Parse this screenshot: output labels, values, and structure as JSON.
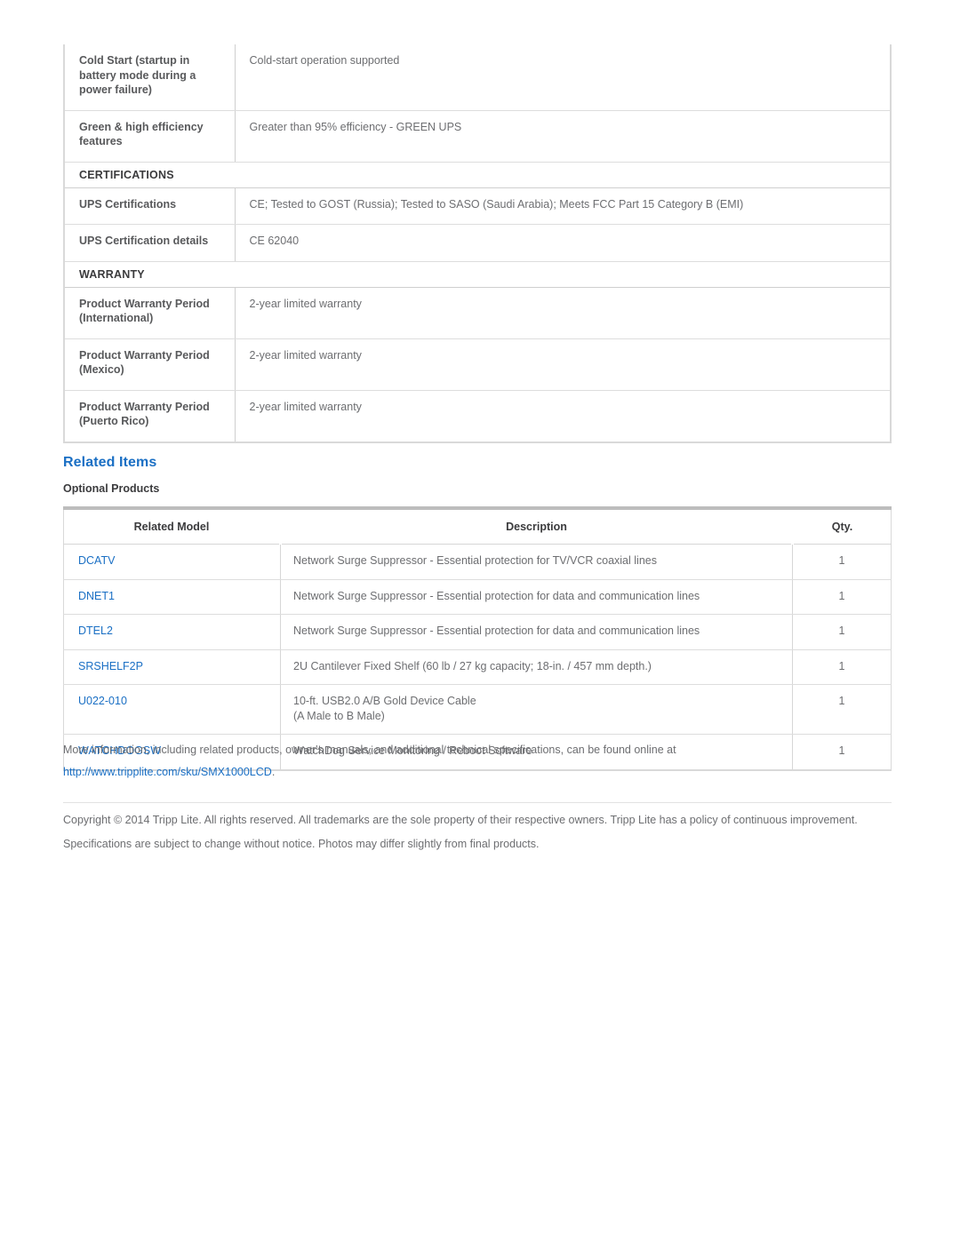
{
  "spec_table": {
    "rows": [
      {
        "kind": "row",
        "label": "Cold Start (startup in battery mode during a power failure)",
        "value": "Cold-start operation supported"
      },
      {
        "kind": "row",
        "label": "Green & high efficiency features",
        "value": "Greater than 95% efficiency - GREEN UPS"
      },
      {
        "kind": "section",
        "label": "CERTIFICATIONS"
      },
      {
        "kind": "row",
        "label": "UPS Certifications",
        "value": "CE; Tested to GOST (Russia); Tested to SASO (Saudi Arabia); Meets FCC Part 15 Category B (EMI)"
      },
      {
        "kind": "row",
        "label": "UPS Certification details",
        "value": "CE 62040"
      },
      {
        "kind": "section",
        "label": "WARRANTY"
      },
      {
        "kind": "row",
        "label": "Product Warranty Period (International)",
        "value": "2-year limited warranty"
      },
      {
        "kind": "row",
        "label": "Product Warranty Period (Mexico)",
        "value": "2-year limited warranty"
      },
      {
        "kind": "row",
        "label": "Product Warranty Period (Puerto Rico)",
        "value": "2-year limited warranty"
      }
    ]
  },
  "related": {
    "heading": "Related Items",
    "subheading": "Optional Products",
    "columns": {
      "model": "Related Model",
      "description": "Description",
      "qty": "Qty."
    },
    "rows": [
      {
        "model": "DCATV",
        "description": "Network Surge Suppressor - Essential protection for TV/VCR coaxial lines",
        "qty": "1"
      },
      {
        "model": "DNET1",
        "description": "Network Surge Suppressor - Essential protection for data and communication lines",
        "qty": "1"
      },
      {
        "model": "DTEL2",
        "description": "Network Surge Suppressor - Essential protection for data and communication lines",
        "qty": "1"
      },
      {
        "model": "SRSHELF2P",
        "description": "2U Cantilever Fixed Shelf (60 lb / 27 kg capacity; 18-in. / 457 mm depth.)",
        "qty": "1"
      },
      {
        "model": "U022-010",
        "description": "10-ft. USB2.0 A/B Gold Device Cable\n(A Male to B Male)",
        "qty": "1"
      },
      {
        "model": "WATCHDOGSW",
        "description": "WatchDog Service Monitoring / Reboot Software",
        "qty": "1"
      }
    ]
  },
  "footer": {
    "more_info_text": "More information, including related products, owner's manuals, and additional technical specifications, can be found online at ",
    "more_info_url_label": "http://www.tripplite.com/sku/SMX1000LCD",
    "more_info_trailing": ".",
    "copyright": "Copyright © 2014 Tripp Lite. All rights reserved. All trademarks are the sole property of their respective owners. Tripp Lite has a policy of continuous improvement. Specifications are subject to change without notice. Photos may differ slightly from final products."
  },
  "colors": {
    "link": "#1a6fc4",
    "heading": "#1a6fc4",
    "label_text": "#58595b",
    "value_text": "#6d6e71",
    "border": "#d9d9d9"
  }
}
